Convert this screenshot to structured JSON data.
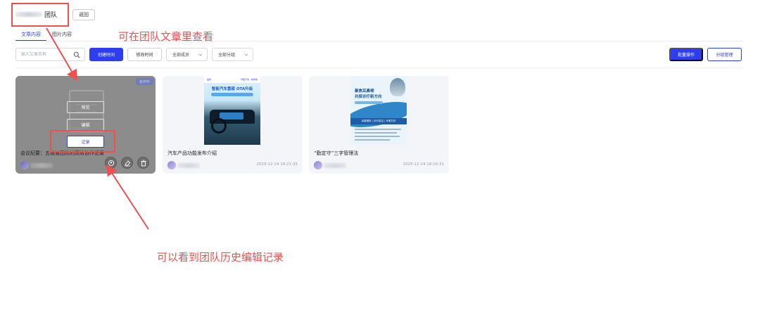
{
  "header": {
    "team_suffix": "团队",
    "back_label": "返回"
  },
  "tabs": [
    {
      "label": "文章内容",
      "active": true
    },
    {
      "label": "图片内容",
      "active": false
    }
  ],
  "filters": {
    "search_placeholder": "输入文章名称",
    "sort_created": "创建时间",
    "sort_modified": "修改时间",
    "member_select": "全部成员",
    "group_select": "全部分组",
    "batch_label": "批量操作",
    "group_manage_label": "分组管理"
  },
  "cards": [
    {
      "title": "会议纪要：五粮液团队的高效协作记录",
      "badge": "协作中",
      "ghost_text": "五粮液团队",
      "actions": {
        "preview": "预览",
        "edit": "编辑",
        "record": "记录"
      }
    },
    {
      "title": "汽车产品功能发布介绍",
      "time": "2025-12-24 18:21:35",
      "poster": {
        "brand": "品牌",
        "tagline": "智能汽车 · 新体验",
        "headline": "智能汽车重磅 OTA升级"
      }
    },
    {
      "title": "“勤定守”三字管理法",
      "time": "2025-12-24 18:20:31",
      "poster": {
        "headline_1": "聚焦耳鼻喉",
        "headline_2": "共探诊疗新方向",
        "band": "耳鼻喉科 | 诊疗前沿 | 专家共识"
      }
    }
  ],
  "annotations": {
    "tip_view": "可在团队文章里查看",
    "tip_record": "可以看到团队历史编辑记录"
  },
  "colors": {
    "accent": "#2d3ef1",
    "annotation": "#ee5050"
  }
}
